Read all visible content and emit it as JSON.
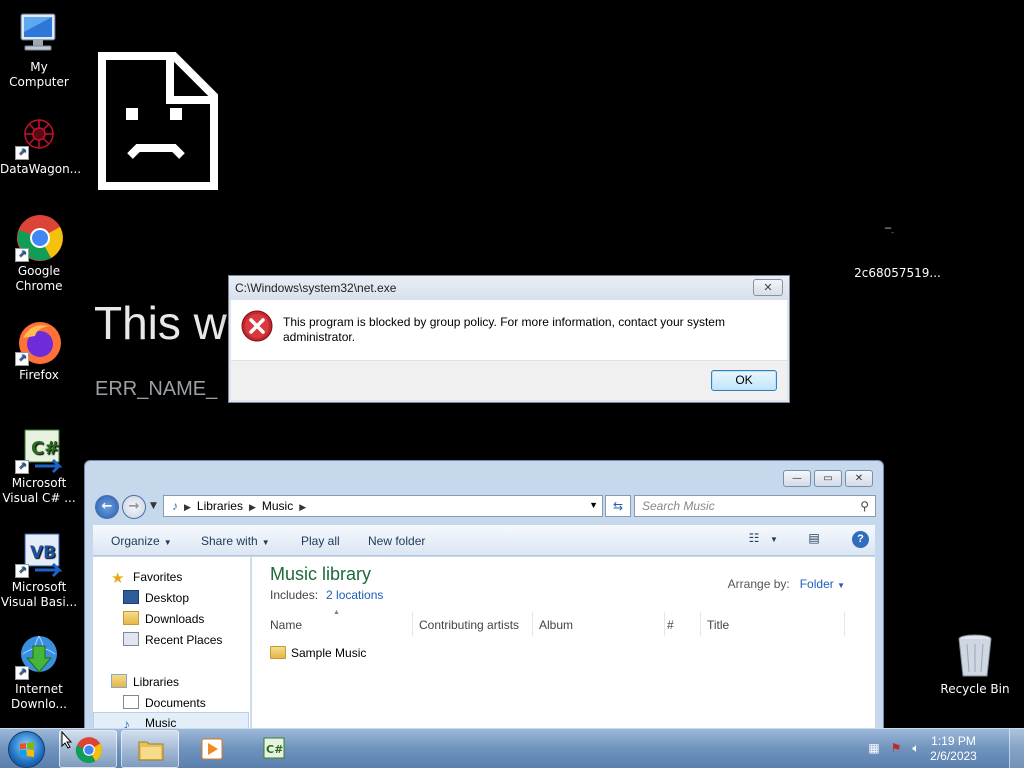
{
  "desktop": {
    "icons": [
      {
        "label": "My Computer"
      },
      {
        "label": "DataWagon..."
      },
      {
        "label": "Google Chrome"
      },
      {
        "label": "Firefox"
      },
      {
        "label": "Microsoft Visual C# ..."
      },
      {
        "label": "Microsoft Visual Basi..."
      },
      {
        "label": "Internet Downlo..."
      },
      {
        "label": "Recycle Bin"
      }
    ],
    "tray_label": "2c68057519..."
  },
  "error_page": {
    "title": "This w",
    "code": "ERR_NAME_"
  },
  "dialog": {
    "title": "C:\\Windows\\system32\\net.exe",
    "close_label": "✕",
    "message": "This program is blocked by group policy. For more information, contact your system administrator.",
    "ok_label": "OK"
  },
  "explorer": {
    "caption_buttons": {
      "minimize": "—",
      "maximize": "▭",
      "close": "✕"
    },
    "breadcrumb": [
      "Libraries",
      "Music"
    ],
    "search_placeholder": "Search Music",
    "commands": {
      "organize": "Organize",
      "share_with": "Share with",
      "play_all": "Play all",
      "new_folder": "New folder"
    },
    "nav": {
      "favorites": "Favorites",
      "desktop": "Desktop",
      "downloads": "Downloads",
      "recent_places": "Recent Places",
      "libraries": "Libraries",
      "documents": "Documents",
      "music": "Music"
    },
    "library_title": "Music library",
    "includes_label": "Includes:",
    "includes_link": "2 locations",
    "arrange_label": "Arrange by:",
    "arrange_value": "Folder",
    "columns": [
      "Name",
      "Contributing artists",
      "Album",
      "#",
      "Title"
    ],
    "items": [
      {
        "name": "Sample Music"
      }
    ]
  },
  "taskbar": {
    "time": "1:19 PM",
    "date": "2/6/2023"
  },
  "colors": {
    "dialog_error": "#c4262e",
    "library_title": "#1d6a3a",
    "link": "#1d5fb5",
    "taskbar": "#6f93bd"
  }
}
